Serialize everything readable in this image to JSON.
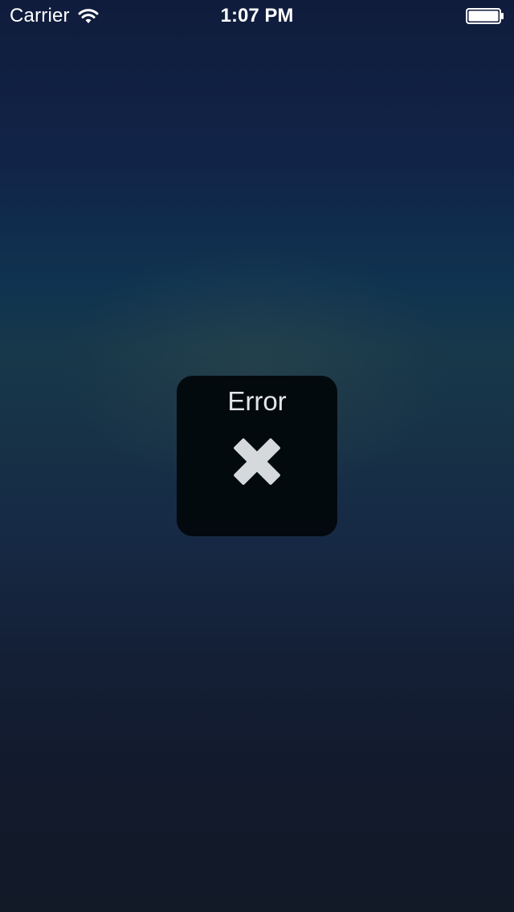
{
  "status_bar": {
    "carrier": "Carrier",
    "time": "1:07 PM",
    "wifi_icon": "wifi-icon",
    "battery_icon": "battery-icon"
  },
  "hud": {
    "title": "Error",
    "icon": "close-icon"
  },
  "colors": {
    "hud_background": "#03090d",
    "hud_text": "#e3e6e8",
    "icon_fill": "#d5d9dc",
    "status_text": "#ffffff"
  }
}
